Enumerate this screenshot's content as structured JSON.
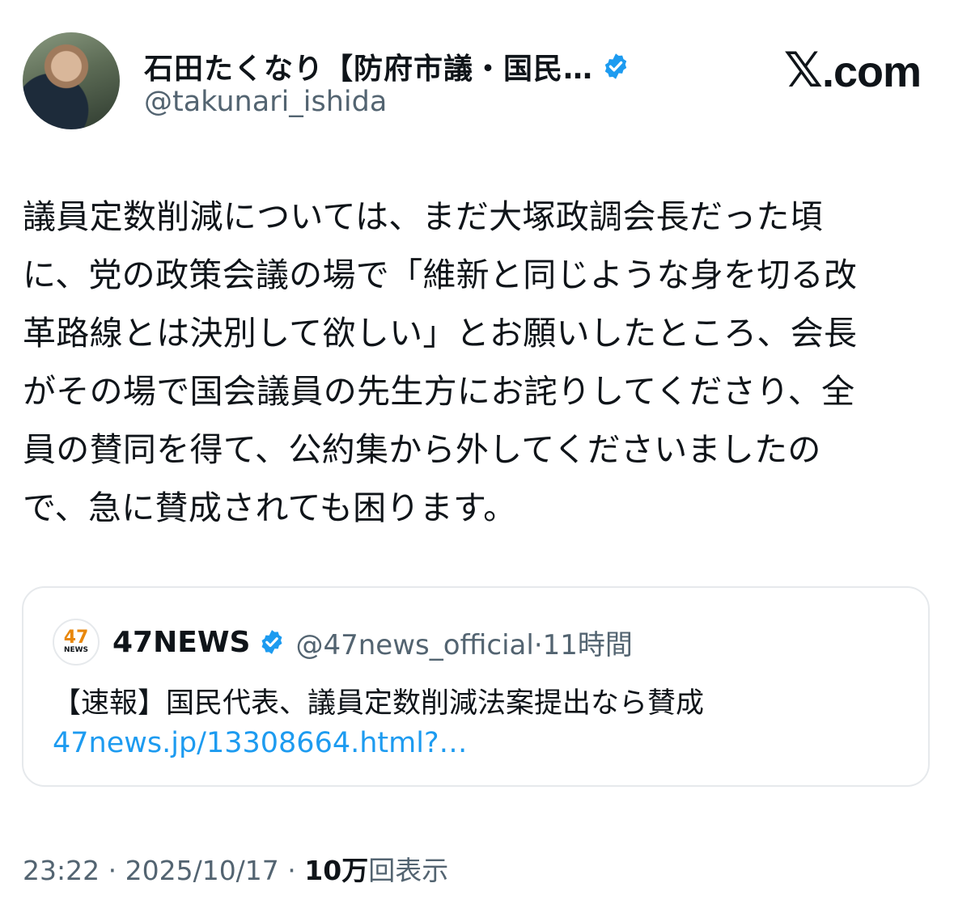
{
  "author": {
    "name": "石田たくなり【防府市議・国民…",
    "handle": "@takunari_ishida",
    "verified_icon": "verified-badge-icon",
    "avatar": "profile-photo"
  },
  "brand": {
    "logo_text": "𝕏",
    "logo_suffix": ".com"
  },
  "post": {
    "lines": [
      "議員定数削減については、まだ大塚政調会長だった頃",
      "に、党の政策会議の場で「維新と同じような身を切る改",
      "革路線とは決別して欲しい」とお願いしたところ、会長",
      "がその場で国会議員の先生方にお詫りしてくださり、全",
      "員の賛同を得て、公約集から外してくださいましたの",
      "で、急に賛成されても困ります。"
    ]
  },
  "quote": {
    "logo_number": "47",
    "logo_text": "NEWS",
    "name": "47NEWS",
    "handle": "@47news_official",
    "separator": "·",
    "time": "11時間",
    "text": "【速報】国民代表、議員定数削減法案提出なら賛成",
    "link": "47news.jp/13308664.html?…"
  },
  "footer": {
    "time": "23:22",
    "sep1": " · ",
    "date": "2025/10/17",
    "sep2": " · ",
    "views_number": "10万",
    "views_label": "回表示"
  },
  "colors": {
    "verified": "#1d9bf0",
    "link": "#1d9bf0",
    "muted": "#536471"
  }
}
